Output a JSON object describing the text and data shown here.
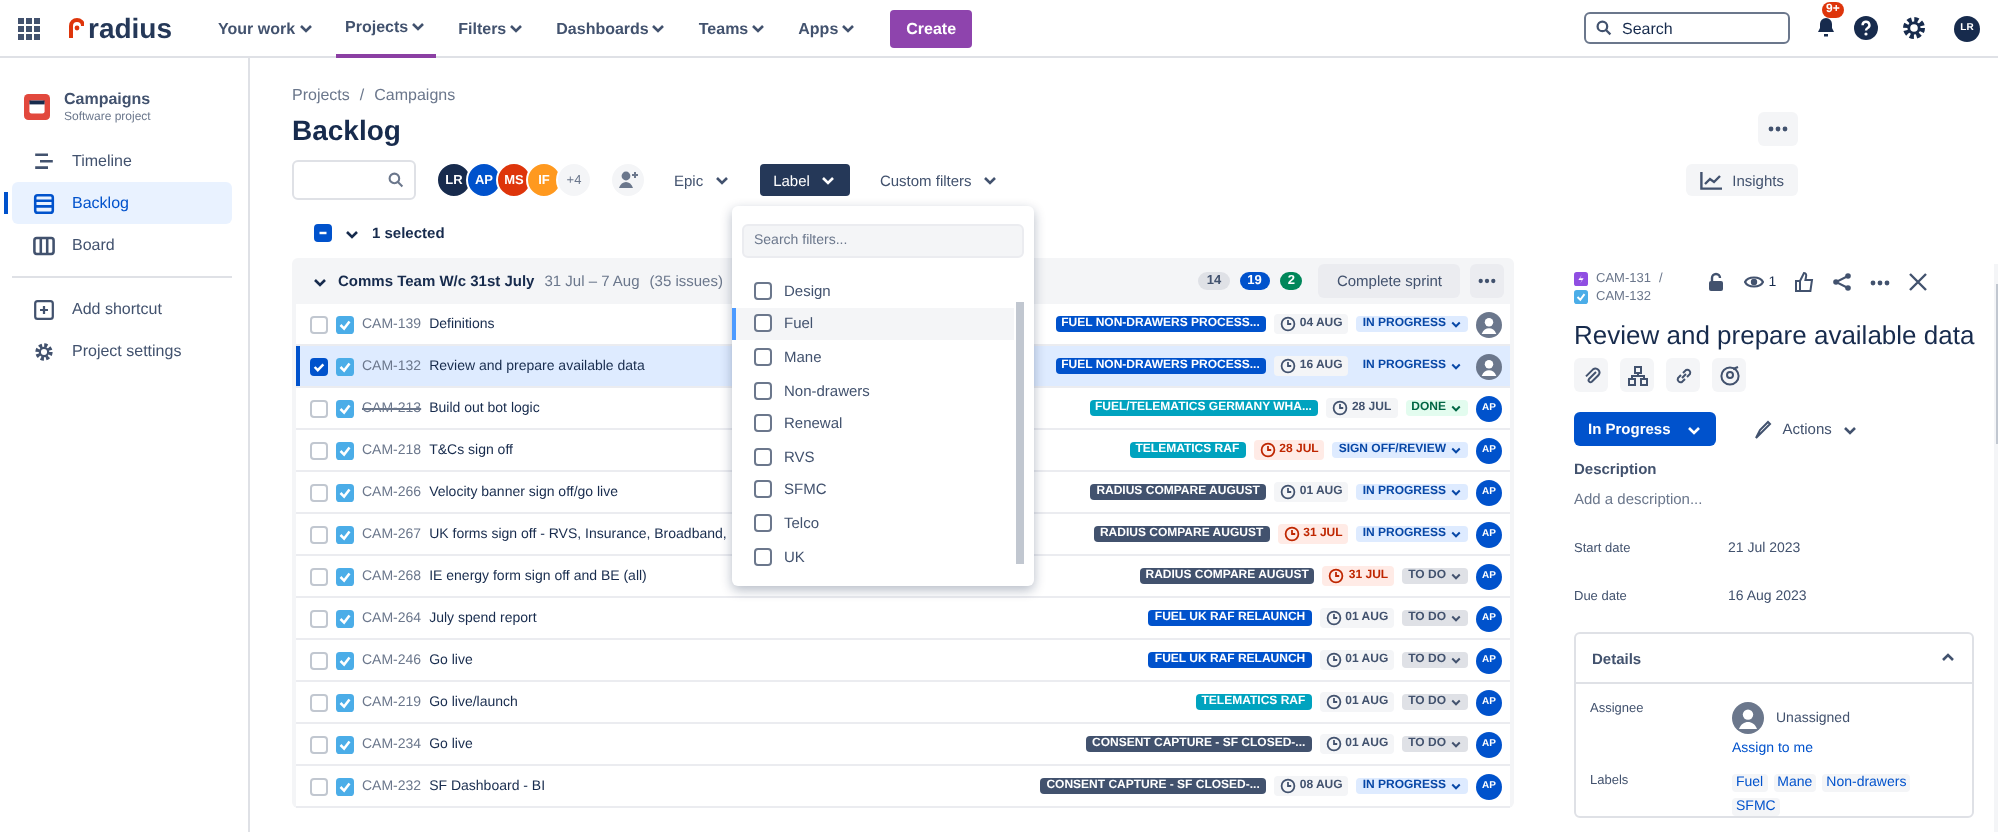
{
  "topnav": {
    "product": "radius",
    "items": [
      {
        "label": "Your work",
        "selected": false
      },
      {
        "label": "Projects",
        "selected": true
      },
      {
        "label": "Filters",
        "selected": false
      },
      {
        "label": "Dashboards",
        "selected": false
      },
      {
        "label": "Teams",
        "selected": false
      },
      {
        "label": "Apps",
        "selected": false
      }
    ],
    "create": "Create",
    "search": {
      "placeholder": "Search"
    },
    "badge": "9+",
    "avatar": "LR"
  },
  "sidebar": {
    "project": "Campaigns",
    "subtitle": "Software project",
    "items": [
      {
        "label": "Timeline",
        "selected": false
      },
      {
        "label": "Backlog",
        "selected": true
      },
      {
        "label": "Board",
        "selected": false
      }
    ],
    "footer": [
      {
        "label": "Add shortcut"
      },
      {
        "label": "Project settings"
      }
    ]
  },
  "breadcrumbs": {
    "separator": "/",
    "items": [
      "Projects",
      "Campaigns"
    ]
  },
  "title": "Backlog",
  "toolbar": {
    "avatars": [
      {
        "initials": "LR",
        "color": "#172b4d"
      },
      {
        "initials": "AP",
        "color": "#0052cc"
      },
      {
        "initials": "MS",
        "color": "#de350b"
      },
      {
        "initials": "IF",
        "color": "#ff991f"
      }
    ],
    "more_avatars": "+4",
    "filters": [
      {
        "label": "Epic",
        "selected": false
      },
      {
        "label": "Label",
        "selected": true
      },
      {
        "label": "Custom filters",
        "selected": false
      }
    ],
    "insights": "Insights"
  },
  "selection": {
    "text": "1 selected",
    "checked": true
  },
  "label_dropdown": {
    "placeholder": "Search filters...",
    "options": [
      {
        "label": "Design",
        "checked": false,
        "highlighted": false
      },
      {
        "label": "Fuel",
        "checked": false,
        "highlighted": true
      },
      {
        "label": "Mane",
        "checked": false,
        "highlighted": false
      },
      {
        "label": "Non-drawers",
        "checked": false,
        "highlighted": false
      },
      {
        "label": "Renewal",
        "checked": false,
        "highlighted": false
      },
      {
        "label": "RVS",
        "checked": false,
        "highlighted": false
      },
      {
        "label": "SFMC",
        "checked": false,
        "highlighted": false
      },
      {
        "label": "Telco",
        "checked": false,
        "highlighted": false
      },
      {
        "label": "UK",
        "checked": false,
        "highlighted": false
      }
    ]
  },
  "sprint": {
    "name": "Comms Team W/c 31st July",
    "dates": "31 Jul – 7 Aug",
    "count": "(35 issues)",
    "counts": [
      {
        "value": "14",
        "kind": "todo"
      },
      {
        "value": "19",
        "kind": "progress"
      },
      {
        "value": "2",
        "kind": "done"
      }
    ],
    "action": "Complete sprint",
    "issues": [
      {
        "key": "CAM-139",
        "title": "Definitions",
        "selected": false,
        "done": false,
        "epic": {
          "label": "FUEL NON-DRAWERS PROCESS...",
          "color": "#0052cc"
        },
        "date": "04 AUG",
        "overdue": false,
        "status": {
          "label": "IN PROGRESS",
          "kind": "progress"
        }
      },
      {
        "key": "CAM-132",
        "title": "Review and prepare available data",
        "selected": true,
        "done": false,
        "epic": {
          "label": "FUEL NON-DRAWERS PROCESS...",
          "color": "#0052cc"
        },
        "date": "16 AUG",
        "overdue": false,
        "status": {
          "label": "IN PROGRESS",
          "kind": "progress"
        }
      },
      {
        "key": "CAM-213",
        "title": "Build out bot logic",
        "selected": false,
        "done": true,
        "epic": {
          "label": "FUEL/TELEMATICS GERMANY WHA...",
          "color": "#00a3bf"
        },
        "date": "28 JUL",
        "overdue": false,
        "status": {
          "label": "DONE",
          "kind": "done"
        },
        "assignee": "AP"
      },
      {
        "key": "CAM-218",
        "title": "T&Cs sign off",
        "selected": false,
        "done": false,
        "epic": {
          "label": "TELEMATICS RAF",
          "color": "#00a3bf"
        },
        "date": "28 JUL",
        "overdue": true,
        "status": {
          "label": "SIGN OFF/REVIEW",
          "kind": "progress"
        },
        "assignee": "AP"
      },
      {
        "key": "CAM-266",
        "title": "Velocity banner sign off/go live",
        "selected": false,
        "done": false,
        "epic": {
          "label": "RADIUS COMPARE AUGUST",
          "color": "#42526e"
        },
        "date": "01 AUG",
        "overdue": false,
        "status": {
          "label": "IN PROGRESS",
          "kind": "progress"
        },
        "assignee": "AP"
      },
      {
        "key": "CAM-267",
        "title": "UK forms sign off - RVS, Insurance, Broadband,",
        "selected": false,
        "done": false,
        "epic": {
          "label": "RADIUS COMPARE AUGUST",
          "color": "#42526e"
        },
        "date": "31 JUL",
        "overdue": true,
        "status": {
          "label": "IN PROGRESS",
          "kind": "progress"
        },
        "assignee": "AP"
      },
      {
        "key": "CAM-268",
        "title": "IE energy form sign off and BE (all)",
        "selected": false,
        "done": false,
        "epic": {
          "label": "RADIUS COMPARE AUGUST",
          "color": "#42526e"
        },
        "date": "31 JUL",
        "overdue": true,
        "status": {
          "label": "TO DO",
          "kind": "todo"
        },
        "assignee": "AP"
      },
      {
        "key": "CAM-264",
        "title": "July spend report",
        "selected": false,
        "done": false,
        "epic": {
          "label": "FUEL UK RAF RELAUNCH",
          "color": "#0052cc"
        },
        "date": "01 AUG",
        "overdue": false,
        "status": {
          "label": "TO DO",
          "kind": "todo"
        },
        "assignee": "AP"
      },
      {
        "key": "CAM-246",
        "title": "Go live",
        "selected": false,
        "done": false,
        "epic": {
          "label": "FUEL UK RAF RELAUNCH",
          "color": "#0052cc"
        },
        "date": "01 AUG",
        "overdue": false,
        "status": {
          "label": "TO DO",
          "kind": "todo"
        },
        "assignee": "AP"
      },
      {
        "key": "CAM-219",
        "title": "Go live/launch",
        "selected": false,
        "done": false,
        "epic": {
          "label": "TELEMATICS RAF",
          "color": "#00a3bf"
        },
        "date": "01 AUG",
        "overdue": false,
        "status": {
          "label": "TO DO",
          "kind": "todo"
        },
        "assignee": "AP"
      },
      {
        "key": "CAM-234",
        "title": "Go live",
        "selected": false,
        "done": false,
        "epic": {
          "label": "CONSENT CAPTURE - SF CLOSED-...",
          "color": "#42526e"
        },
        "date": "01 AUG",
        "overdue": false,
        "status": {
          "label": "TO DO",
          "kind": "todo"
        },
        "assignee": "AP"
      },
      {
        "key": "CAM-232",
        "title": "SF Dashboard - BI",
        "selected": false,
        "done": false,
        "epic": {
          "label": "CONSENT CAPTURE - SF CLOSED-...",
          "color": "#42526e"
        },
        "date": "08 AUG",
        "overdue": false,
        "status": {
          "label": "IN PROGRESS",
          "kind": "progress"
        },
        "assignee": "AP"
      }
    ]
  },
  "detail": {
    "parent": "CAM-131",
    "separator": "/",
    "key": "CAM-132",
    "watchers": "1",
    "title": "Review and prepare available data",
    "status": "In Progress",
    "actions": "Actions",
    "description_label": "Description",
    "description_placeholder": "Add a description...",
    "fields": [
      {
        "label": "Start date",
        "value": "21 Jul 2023"
      },
      {
        "label": "Due date",
        "value": "16 Aug 2023"
      }
    ],
    "details": {
      "title": "Details",
      "assignee_label": "Assignee",
      "assignee": "Unassigned",
      "assign_link": "Assign to me",
      "labels_label": "Labels",
      "labels": [
        "Fuel",
        "Mane",
        "Non-drawers",
        "SFMC"
      ]
    }
  }
}
